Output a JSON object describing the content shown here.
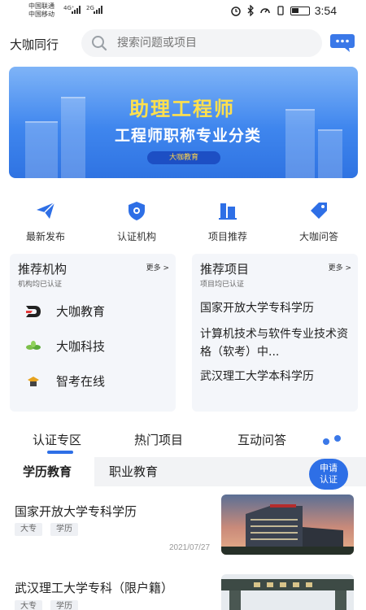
{
  "status_bar": {
    "carrier1": "中国联通",
    "carrier2": "中国移动",
    "signal1": "4G⁺",
    "signal2": "2G",
    "time": "3:54"
  },
  "header": {
    "title": "大咖同行",
    "search_placeholder": "搜索问题或项目",
    "icons": [
      "search-icon",
      "message-icon"
    ]
  },
  "banner": {
    "title": "助理工程师",
    "subtitle": "工程师职称专业分类",
    "pill": "大咖教育"
  },
  "quick_nav": [
    {
      "label": "最新发布",
      "icon": "paper-plane-icon"
    },
    {
      "label": "认证机构",
      "icon": "shield-icon"
    },
    {
      "label": "项目推荐",
      "icon": "building-icon"
    },
    {
      "label": "大咖问答",
      "icon": "tag-icon"
    }
  ],
  "recommend_orgs": {
    "title": "推荐机构",
    "subtitle": "机构均已认证",
    "more": "更多 >",
    "items": [
      {
        "name": "大咖教育",
        "icon": "dk-logo-icon"
      },
      {
        "name": "大咖科技",
        "icon": "leaf-logo-icon"
      },
      {
        "name": "智考在线",
        "icon": "zk-logo-icon"
      }
    ]
  },
  "recommend_projects": {
    "title": "推荐项目",
    "subtitle": "项目均已认证",
    "more": "更多 >",
    "items": [
      "国家开放大学专科学历",
      "计算机技术与软件专业技术资格（软考）中...",
      "武汉理工大学本科学历"
    ]
  },
  "tabs": {
    "items": [
      "认证专区",
      "热门项目",
      "互动问答"
    ],
    "active": "认证专区"
  },
  "sub_tabs": {
    "items": [
      "学历教育",
      "职业教育"
    ],
    "active": "学历教育",
    "apply_button": [
      "申请",
      "认证"
    ]
  },
  "list": [
    {
      "title": "国家开放大学专科学历",
      "tags": [
        "大专",
        "学历"
      ],
      "date": "2021/07/27"
    },
    {
      "title": "武汉理工大学专科（限户籍）",
      "tags": [
        "大专",
        "学历"
      ],
      "date": ""
    }
  ],
  "colors": {
    "accent": "#2e6fe6",
    "banner_title": "#ffe04d"
  }
}
